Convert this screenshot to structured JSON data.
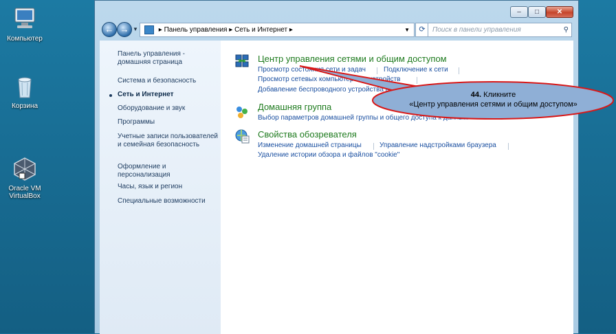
{
  "desktop": {
    "icons": [
      {
        "label": "Компьютер",
        "icon": "computer-icon"
      },
      {
        "label": "Корзина",
        "icon": "recycle-bin-icon"
      },
      {
        "label": "Oracle VM\nVirtualBox",
        "icon": "virtualbox-icon"
      }
    ]
  },
  "window": {
    "controls": {
      "minimize": "–",
      "maximize": "□",
      "close": "✕"
    },
    "breadcrumb": [
      "Панель управления",
      "Сеть и Интернет"
    ],
    "search_placeholder": "Поиск в панели управления"
  },
  "left_nav": {
    "items": [
      "Панель управления - домашняя страница",
      "Система и безопасность",
      "Сеть и Интернет",
      "Оборудование и звук",
      "Программы",
      "Учетные записи пользователей и семейная безопасность",
      "Оформление и персонализация",
      "Часы, язык и регион",
      "Специальные возможности"
    ],
    "active_index": 2
  },
  "categories": [
    {
      "title": "Центр управления сетями и общим доступом",
      "icon": "network-center-icon",
      "links": [
        "Просмотр состояния сети и задач",
        "Подключение к сети",
        "Просмотр сетевых компьютеров и устройств",
        "Добавление беспроводного устройства в сеть"
      ]
    },
    {
      "title": "Домашняя группа",
      "icon": "homegroup-icon",
      "links": [
        "Выбор параметров домашней группы и общего доступа к данным"
      ]
    },
    {
      "title": "Свойства обозревателя",
      "icon": "internet-options-icon",
      "links": [
        "Изменение домашней страницы",
        "Управление надстройками браузера",
        "Удаление истории обзора и файлов \"cookie\""
      ]
    }
  ],
  "callout": {
    "step": "44.",
    "line1": "Кликните",
    "line2": "«Центр управления сетями и общим доступом»",
    "fill": "#8fafd6",
    "border": "#d81818"
  }
}
